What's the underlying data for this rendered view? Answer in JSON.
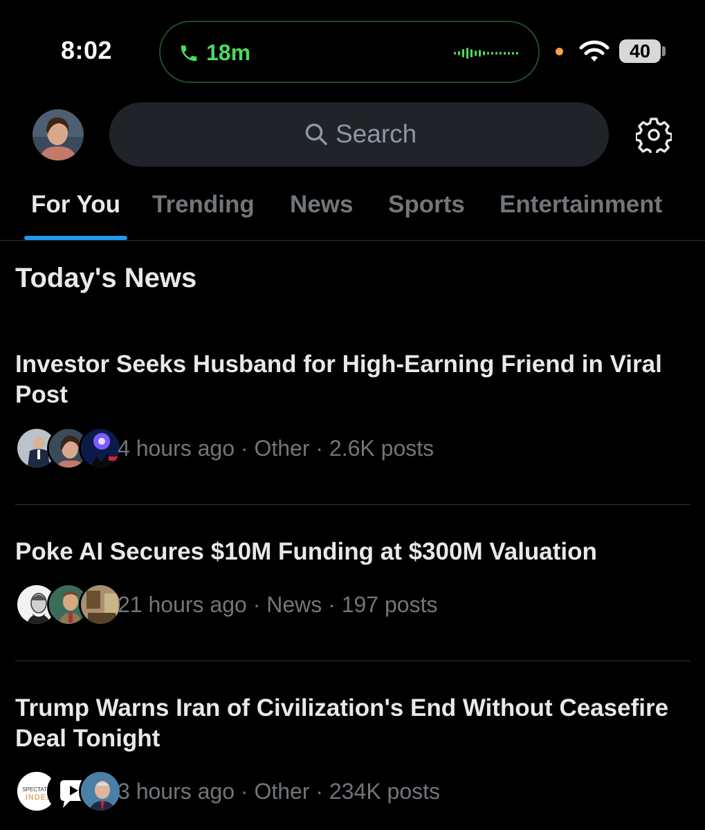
{
  "status_bar": {
    "time": "8:02",
    "call_duration": "18m",
    "battery": "40",
    "call_color": "#4cd964",
    "privacy_dot_color": "#ff9f43"
  },
  "header": {
    "search_placeholder": "Search",
    "settings_icon": "gear-icon",
    "search_icon": "search-icon"
  },
  "tabs": [
    {
      "label": "For You",
      "active": true
    },
    {
      "label": "Trending",
      "active": false
    },
    {
      "label": "News",
      "active": false
    },
    {
      "label": "Sports",
      "active": false
    },
    {
      "label": "Entertainment",
      "active": false
    }
  ],
  "accent_color": "#1d9bf0",
  "section_title": "Today's News",
  "news": [
    {
      "headline": "Investor Seeks Husband for High-Earning Friend in Viral Post",
      "meta": "4 hours ago · Other · 2.6K posts"
    },
    {
      "headline": "Poke AI Secures $10M Funding at $300M Valuation",
      "meta": "21 hours ago · News · 197 posts"
    },
    {
      "headline": "Trump Warns Iran of Civilization's End Without Ceasefire Deal Tonight",
      "meta": "3 hours ago · Other · 234K posts",
      "logo_text_top": "SPECTATOR",
      "logo_text_bottom": "INDEX"
    }
  ]
}
